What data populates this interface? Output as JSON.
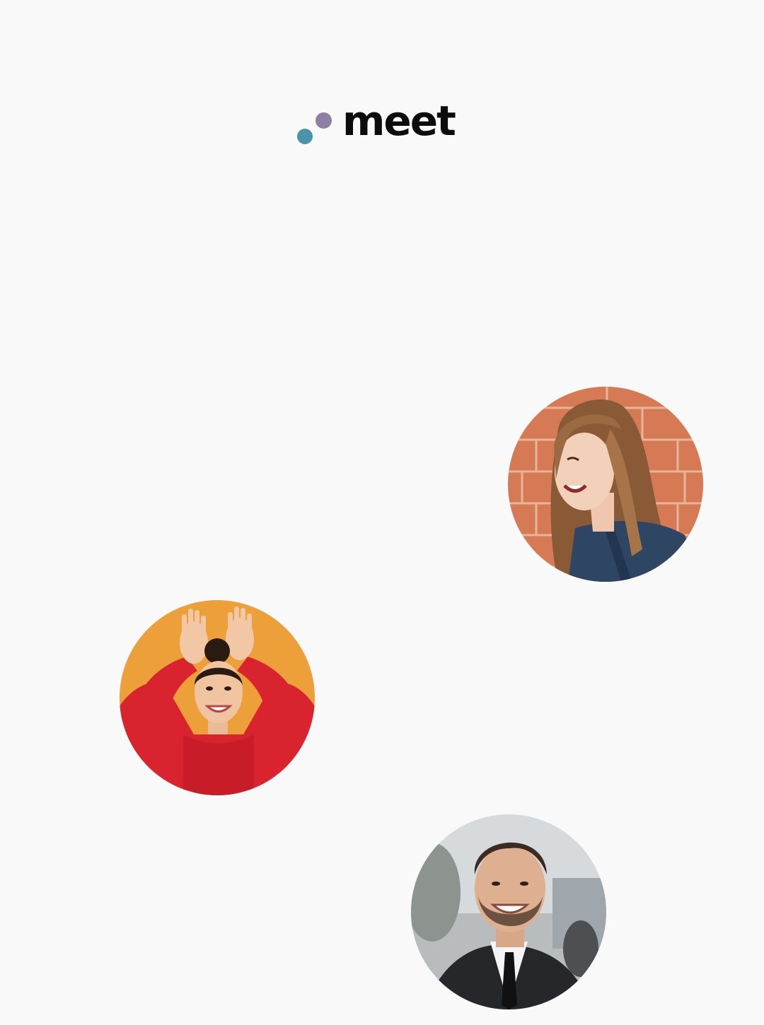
{
  "brand": {
    "name": "meet",
    "dot_colors": {
      "teal": "#4a94a8",
      "purple": "#8e80a4"
    }
  },
  "avatars": [
    {
      "name": "avatar-woman-brick-wall",
      "background": "#d57a54"
    },
    {
      "name": "avatar-woman-red-sweater",
      "background": "#eda03a"
    },
    {
      "name": "avatar-man-suit",
      "background": "#cfd3d6"
    }
  ]
}
